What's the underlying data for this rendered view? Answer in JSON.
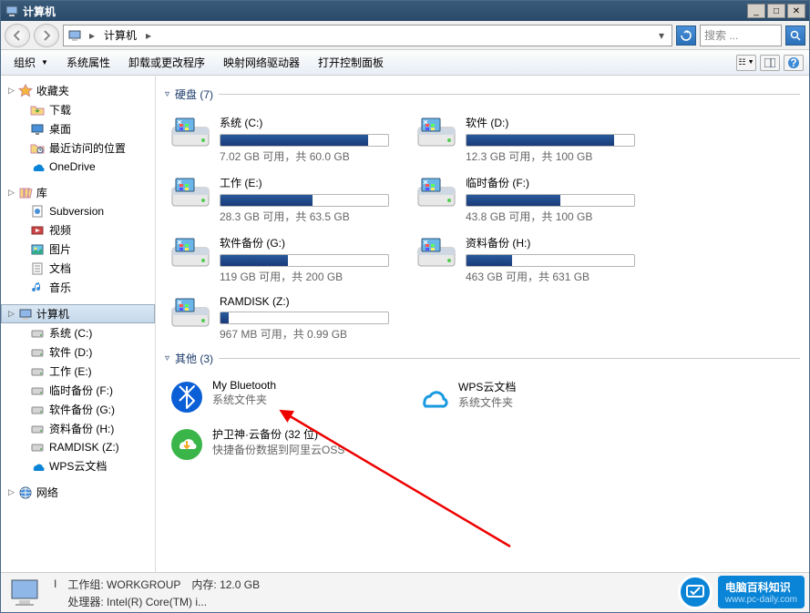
{
  "window": {
    "title": "计算机"
  },
  "address": {
    "crumb": "计算机"
  },
  "search": {
    "placeholder": "搜索 ..."
  },
  "toolbar": {
    "organize": "组织",
    "sysprops": "系统属性",
    "uninstall": "卸载或更改程序",
    "mapdrive": "映射网络驱动器",
    "controlpanel": "打开控制面板"
  },
  "sidebar": {
    "favorites": {
      "label": "收藏夹",
      "items": [
        {
          "label": "下载"
        },
        {
          "label": "桌面"
        },
        {
          "label": "最近访问的位置"
        },
        {
          "label": "OneDrive"
        }
      ]
    },
    "libraries": {
      "label": "库",
      "items": [
        {
          "label": "Subversion"
        },
        {
          "label": "视频"
        },
        {
          "label": "图片"
        },
        {
          "label": "文档"
        },
        {
          "label": "音乐"
        }
      ]
    },
    "computer": {
      "label": "计算机",
      "items": [
        {
          "label": "系统 (C:)"
        },
        {
          "label": "软件 (D:)"
        },
        {
          "label": "工作 (E:)"
        },
        {
          "label": "临时备份 (F:)"
        },
        {
          "label": "软件备份 (G:)"
        },
        {
          "label": "资料备份 (H:)"
        },
        {
          "label": "RAMDISK (Z:)"
        },
        {
          "label": "WPS云文档"
        }
      ]
    },
    "network": {
      "label": "网络"
    }
  },
  "content": {
    "drives_header": "硬盘 (7)",
    "drives": [
      {
        "name": "系统 (C:)",
        "free": "7.02 GB 可用，共 60.0 GB",
        "pct": 88
      },
      {
        "name": "软件 (D:)",
        "free": "12.3 GB 可用，共 100 GB",
        "pct": 88
      },
      {
        "name": "工作 (E:)",
        "free": "28.3 GB 可用，共 63.5 GB",
        "pct": 55
      },
      {
        "name": "临时备份 (F:)",
        "free": "43.8 GB 可用，共 100 GB",
        "pct": 56
      },
      {
        "name": "软件备份 (G:)",
        "free": "119 GB 可用，共 200 GB",
        "pct": 40
      },
      {
        "name": "资料备份 (H:)",
        "free": "463 GB 可用，共 631 GB",
        "pct": 27
      },
      {
        "name": "RAMDISK (Z:)",
        "free": "967 MB 可用，共 0.99 GB",
        "pct": 5
      }
    ],
    "other_header": "其他 (3)",
    "others": [
      {
        "name": "My Bluetooth",
        "sub": "系统文件夹",
        "icon": "bluetooth"
      },
      {
        "name": "WPS云文档",
        "sub": "系统文件夹",
        "icon": "cloud"
      },
      {
        "name": "护卫神·云备份 (32 位)",
        "sub": "快捷备份数据到阿里云OSS",
        "icon": "cloudbackup"
      }
    ]
  },
  "status": {
    "hostname_prefix": "I",
    "workgroup_label": "工作组:",
    "workgroup": "WORKGROUP",
    "mem_label": "内存:",
    "mem": "12.0 GB",
    "cpu_label": "处理器:",
    "cpu": "Intel(R) Core(TM) i..."
  },
  "watermark": {
    "title": "电脑百科知识",
    "url": "www.pc-daily.com"
  }
}
